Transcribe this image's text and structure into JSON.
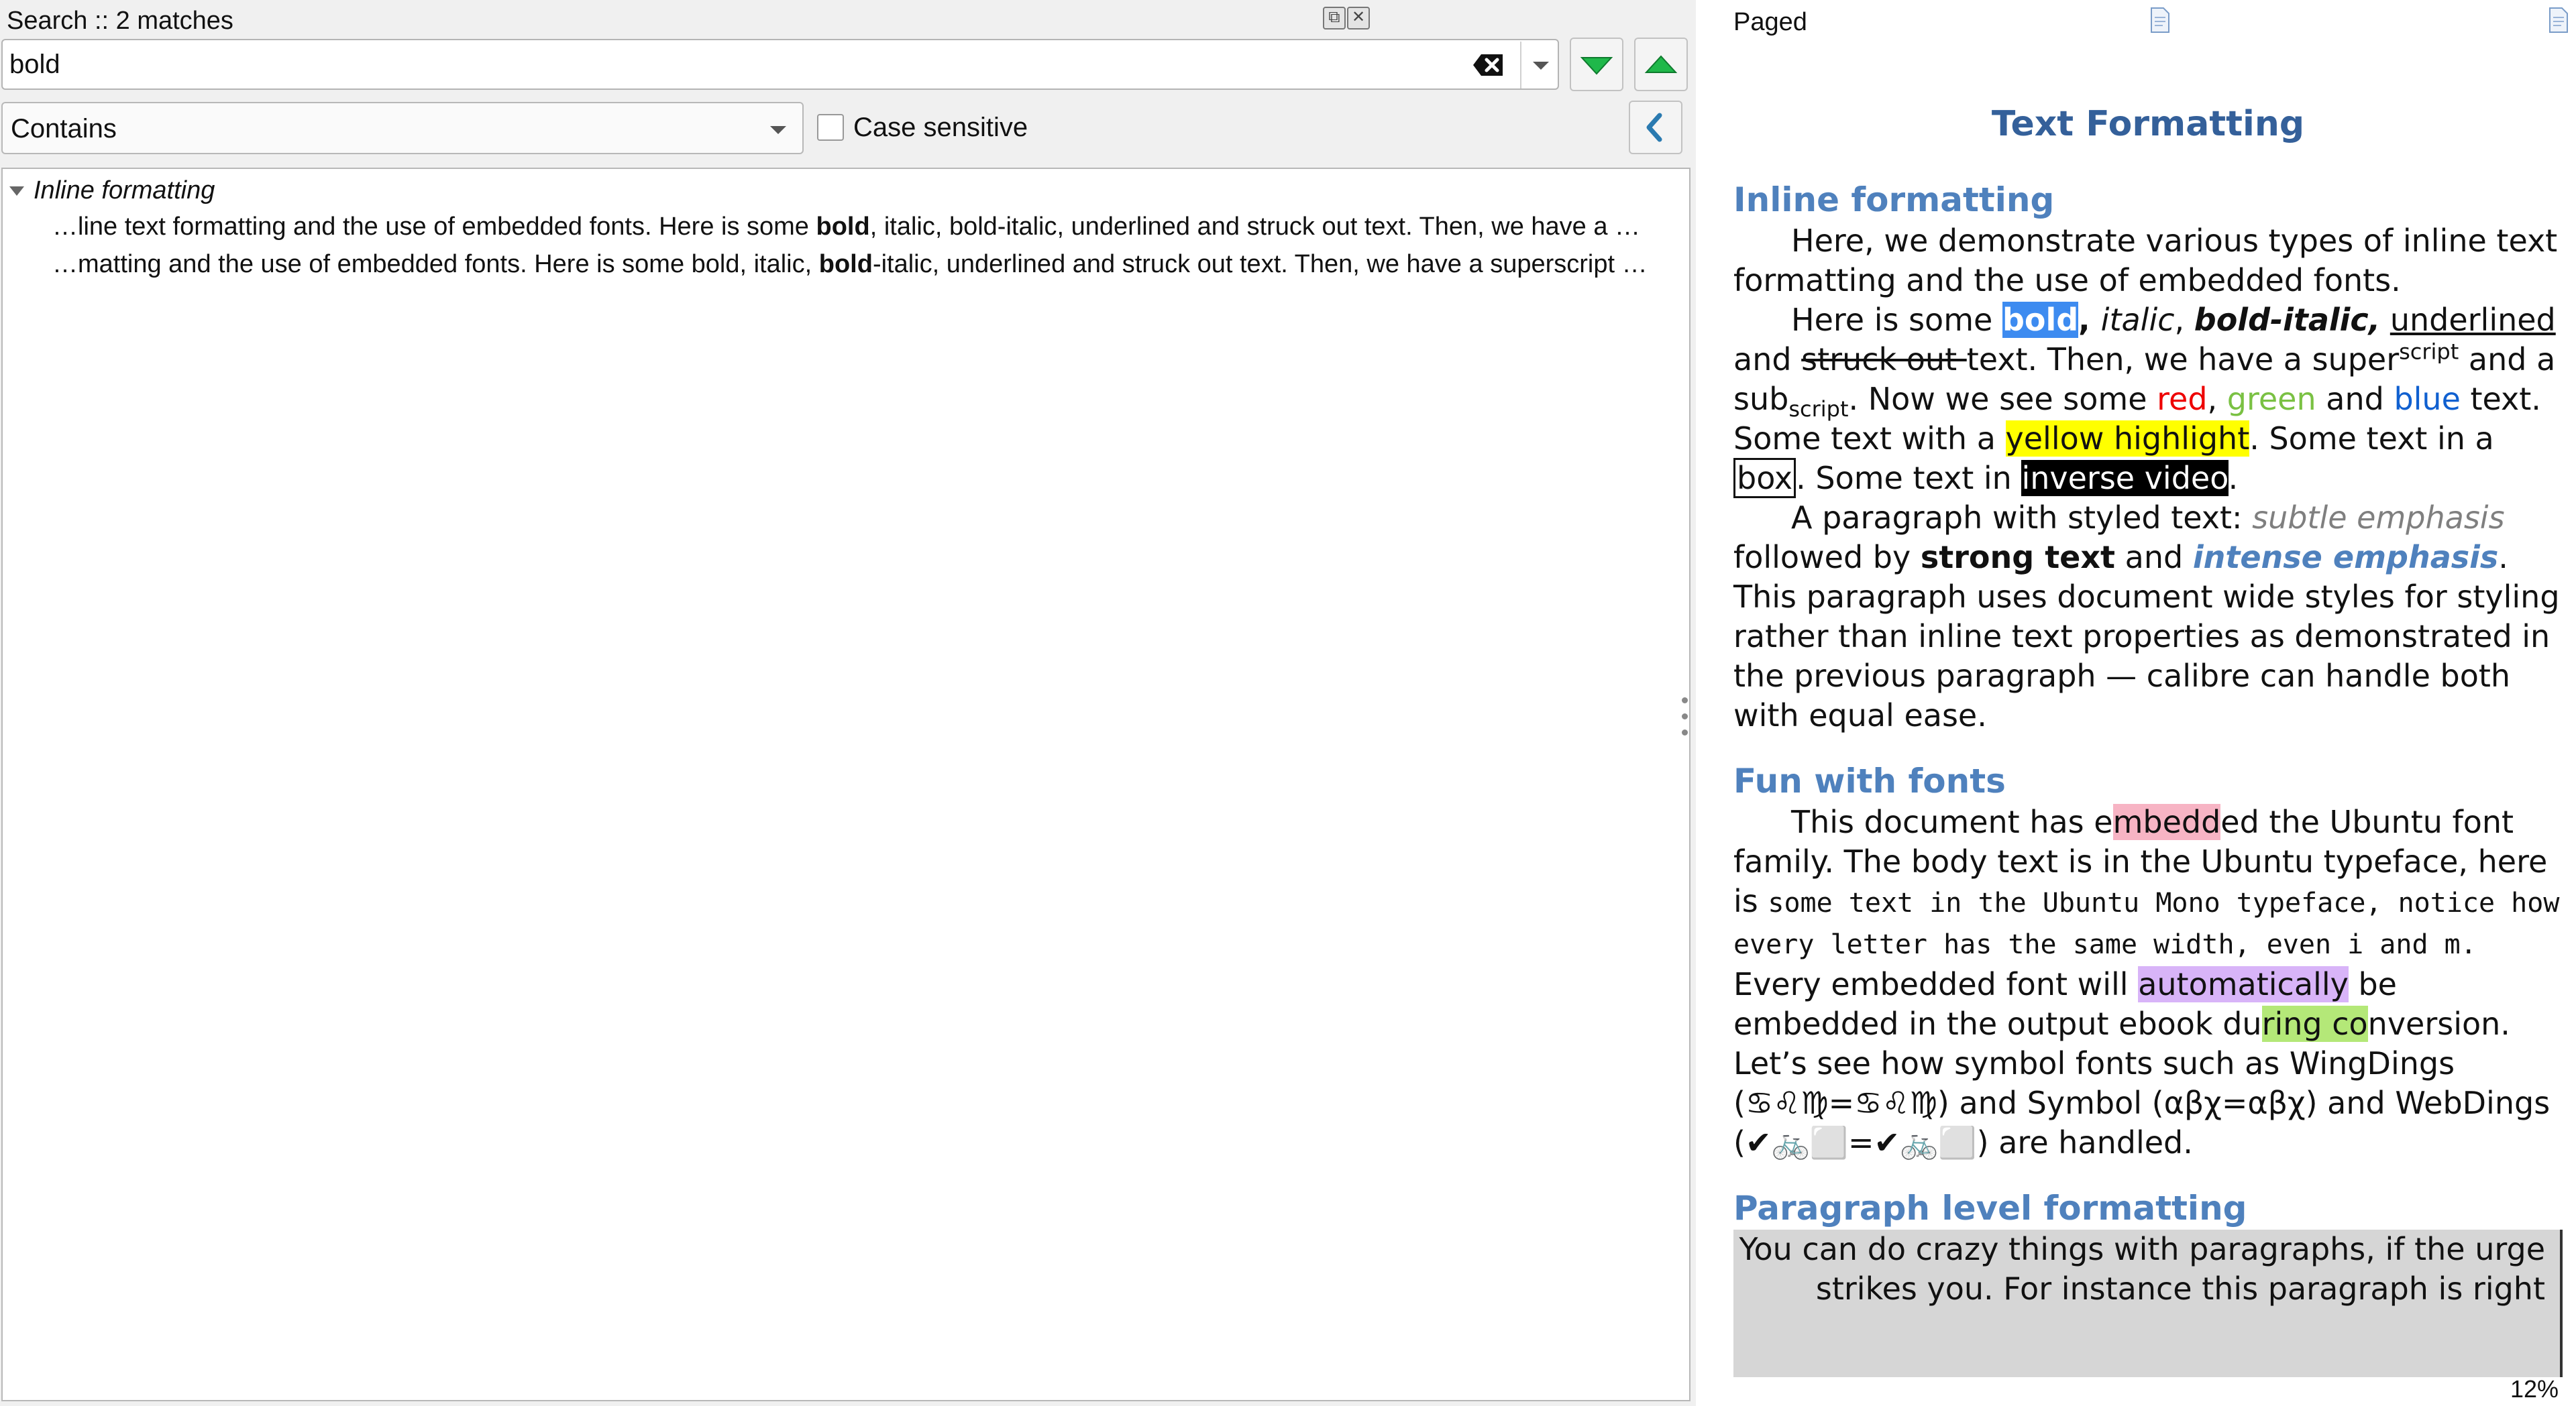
{
  "search_panel": {
    "title": "Search :: 2 matches",
    "query": "bold",
    "mode": "Contains",
    "case_sensitive_label": "Case sensitive",
    "case_sensitive_checked": false,
    "group": "Inline formatting",
    "results": [
      {
        "before": "…line text formatting and the use of embedded fonts. Here is some ",
        "match": "bold",
        "after": ", italic, bold-italic, underlined and struck out text. Then, we have a …"
      },
      {
        "before": "…matting and the use of embedded fonts. Here is some bold, italic, ",
        "match": "bold",
        "after": "-italic, underlined and struck out text. Then, we have a superscript …"
      }
    ]
  },
  "viewer": {
    "mode_label": "Paged",
    "progress": "12%",
    "doc": {
      "title": "Text Formatting",
      "h_inline": "Inline formatting",
      "p1": "Here, we demonstrate various types of inline text formatting and the use of embedded fonts.",
      "p2": {
        "a": "Here is some ",
        "bold": "bold",
        "comma1": ", ",
        "italic": "italic",
        "comma2": ", ",
        "bold_italic": "bold-italic,",
        "sp1": " ",
        "underlined": "underlined",
        "and1": " and ",
        "struck": "struck out ",
        "then": "text. Then, we have a super",
        "sup": "script",
        "and2": " and a sub",
        "sub": "script",
        "now": ". Now we see some ",
        "red": "red",
        "c3": ", ",
        "green": "green",
        "and3": " and ",
        "blue": "blue",
        "text_end": " text. Some text with a ",
        "yellow": "yellow highlight",
        "box_pre": ". Some text in a ",
        "box": "box",
        "inv_pre": ". Some text in ",
        "inverse": "inverse video",
        "end": "."
      },
      "p3": {
        "a": "A paragraph with styled text: ",
        "subtle": "subtle emphasis",
        "b": " followed by ",
        "strong": "strong text",
        "c": " and ",
        "intense": "intense emphasis",
        "d": ". This paragraph uses document wide styles for styling rather than inline text properties as demonstrated in the previous paragraph — calibre can handle both with equal ease."
      },
      "h_fonts": "Fun with fonts",
      "p4": {
        "a": "This document has e",
        "embedded_hl": "mbedd",
        "b": "ed the Ubuntu font family. The body text is in the Ubuntu typeface, here is ",
        "mono": "some text in the Ubuntu Mono typeface, notice how every letter has the same width, even i and m.",
        "c": " Every embedded font will ",
        "auto_hl": "automatically",
        "d": " be embedded in the output ebook du",
        "ring_hl": "ring co",
        "e": "nversion. Let’s see how symbol fonts such as WingDings (♋♌♍=♋♌♍) and Symbol (αβχ=αβχ) and WebDings (✔🚲⬜=✔🚲⬜) are handled."
      },
      "h_para": "Paragraph level formatting",
      "p5": "You can do crazy things with paragraphs, if the urge strikes you. For instance this paragraph is right"
    }
  },
  "icons": [
    "restore-icon",
    "close-icon",
    "clear-icon",
    "chevron-down-icon",
    "arrow-down-icon",
    "arrow-up-icon",
    "chevron-left-icon",
    "page-icon"
  ],
  "colors": {
    "accent_green": "#1fb84a",
    "heading_blue": "#4f81bd",
    "title_blue": "#34609a",
    "back_arrow": "#2a7ab0"
  }
}
